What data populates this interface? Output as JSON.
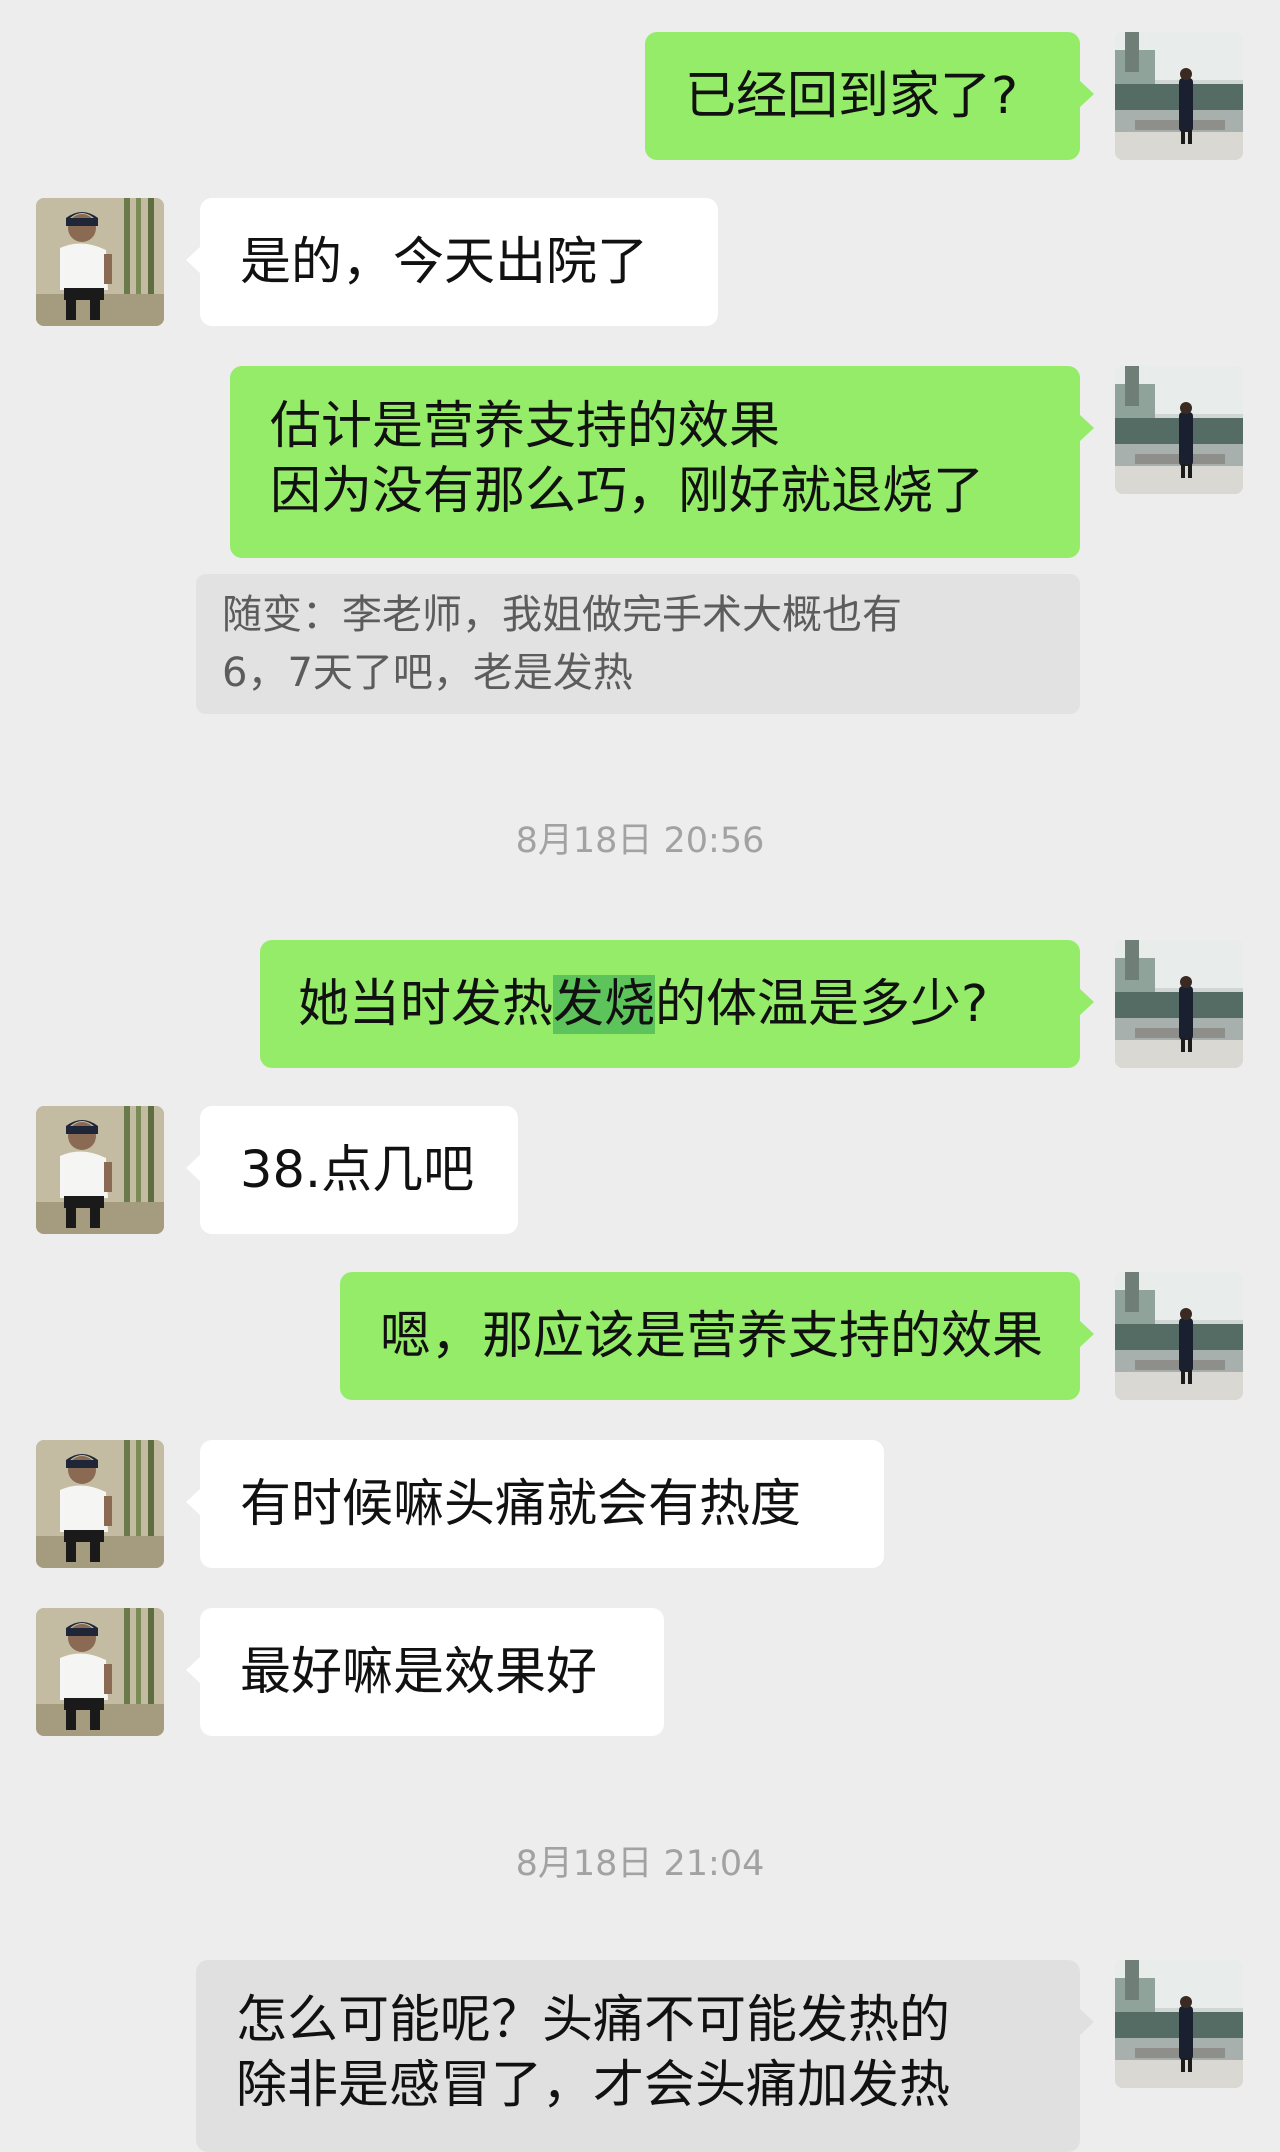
{
  "colors": {
    "background": "#ededed",
    "sent_bubble": "#95ec69",
    "received_bubble": "#ffffff",
    "quote_bubble": "#e2e2e2",
    "timestamp_text": "#a2a2a2"
  },
  "messages": {
    "m1": {
      "text": "已经回到家了?"
    },
    "m2": {
      "text": "是的，今天出院了"
    },
    "m3": {
      "line1": "估计是营养支持的效果",
      "line2": "因为没有那么巧，刚好就退烧了"
    },
    "quote1": {
      "line1": "随变：李老师，我姐做完手术大概也有",
      "line2": "6，7天了吧，老是发热"
    },
    "time1": "8月18日 20:56",
    "m4": {
      "before": "她当时发热",
      "highlight": "发烧",
      "after": "的体温是多少?"
    },
    "m5": {
      "text": "38.点几吧"
    },
    "m6": {
      "text": "嗯，那应该是营养支持的效果"
    },
    "m7": {
      "text": "有时候嘛头痛就会有热度"
    },
    "m8": {
      "text": "最好嘛是效果好"
    },
    "time2": "8月18日 21:04",
    "m9": {
      "line1": "怎么可能呢？头痛不可能发热的",
      "line2": "除非是感冒了，才会头痛加发热"
    }
  },
  "avatars": {
    "self": "avatar-photo-man-by-lake",
    "other": "avatar-photo-boy-in-cap"
  }
}
